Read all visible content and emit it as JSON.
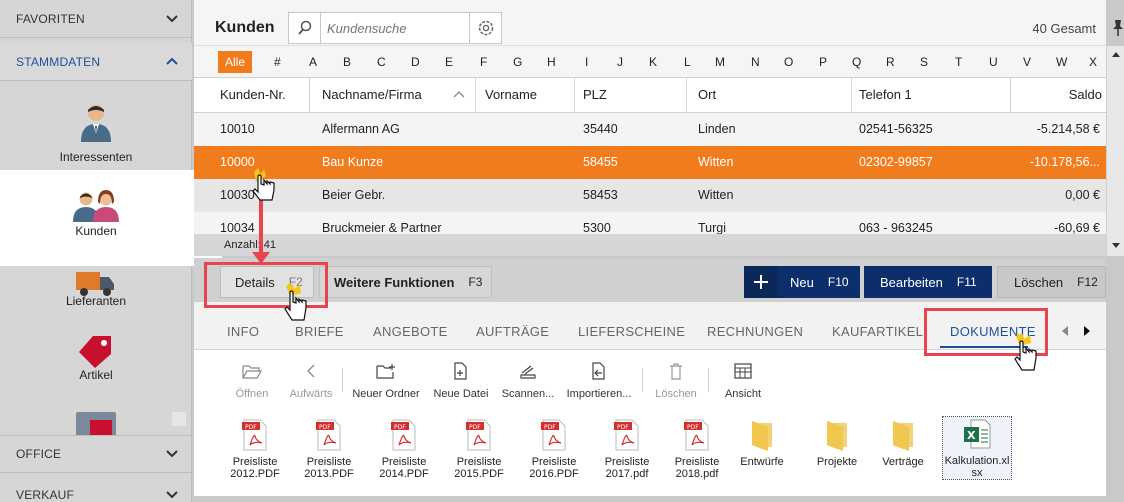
{
  "sidebar": {
    "sections": {
      "favoriten": "FAVORITEN",
      "stammdaten": "STAMMDATEN",
      "office": "OFFICE",
      "verkauf": "VERKAUF"
    },
    "items": [
      {
        "label": "Interessenten",
        "icon": "person-icon"
      },
      {
        "label": "Kunden",
        "icon": "people-icon"
      },
      {
        "label": "Lieferanten",
        "icon": "truck-icon"
      },
      {
        "label": "Artikel",
        "icon": "tag-icon"
      }
    ]
  },
  "header": {
    "title": "Kunden",
    "search_placeholder": "Kundensuche",
    "total": "40 Gesamt"
  },
  "alphabet": [
    "Alle",
    "#",
    "A",
    "B",
    "C",
    "D",
    "E",
    "F",
    "G",
    "H",
    "I",
    "J",
    "K",
    "L",
    "M",
    "N",
    "O",
    "P",
    "Q",
    "R",
    "S",
    "T",
    "U",
    "V",
    "W",
    "X"
  ],
  "table": {
    "columns": [
      "Kunden-Nr.",
      "Nachname/Firma",
      "Vorname",
      "PLZ",
      "Ort",
      "Telefon 1",
      "Saldo"
    ],
    "rows": [
      [
        "10010",
        "Alfermann AG",
        "",
        "35440",
        "Linden",
        "02541-56325",
        "-5.214,58 €"
      ],
      [
        "10000",
        "Bau Kunze",
        "",
        "58455",
        "Witten",
        "02302-99857",
        "-10.178,56..."
      ],
      [
        "10030",
        "Beier Gebr.",
        "",
        "58453",
        "Witten",
        "",
        "0,00 €"
      ],
      [
        "10034",
        "Bruckmeier & Partner",
        "",
        "5300",
        "Turgi",
        "063 - 963245",
        "-60,69 €"
      ]
    ],
    "count_label": "Anzahl: 41"
  },
  "actions": {
    "details": {
      "label": "Details",
      "key": "F2"
    },
    "weitere": {
      "label": "Weitere Funktionen",
      "key": "F3"
    },
    "neu": {
      "label": "Neu",
      "key": "F10"
    },
    "bearbeiten": {
      "label": "Bearbeiten",
      "key": "F11"
    },
    "loeschen": {
      "label": "Löschen",
      "key": "F12"
    }
  },
  "tabs": [
    "INFO",
    "BRIEFE",
    "ANGEBOTE",
    "AUFTRÄGE",
    "LIEFERSCHEINE",
    "RECHNUNGEN",
    "KAUFARTIKEL",
    "DOKUMENTE"
  ],
  "toolbar": [
    "Öffnen",
    "Aufwärts",
    "Neuer Ordner",
    "Neue Datei",
    "Scannen...",
    "Importieren...",
    "Löschen",
    "Ansicht"
  ],
  "files": [
    {
      "name": "Preisliste 2012.PDF",
      "type": "pdf"
    },
    {
      "name": "Preisliste 2013.PDF",
      "type": "pdf"
    },
    {
      "name": "Preisliste 2014.PDF",
      "type": "pdf"
    },
    {
      "name": "Preisliste 2015.PDF",
      "type": "pdf"
    },
    {
      "name": "Preisliste 2016.PDF",
      "type": "pdf"
    },
    {
      "name": "Preisliste 2017.pdf",
      "type": "pdf"
    },
    {
      "name": "Preisliste 2018.pdf",
      "type": "pdf"
    },
    {
      "name": "Entwürfe",
      "type": "folder"
    },
    {
      "name": "Projekte",
      "type": "folder"
    },
    {
      "name": "Verträge",
      "type": "folder"
    },
    {
      "name": "Kalkulation.xlsx",
      "type": "xlsx"
    }
  ],
  "colors": {
    "accent": "#f07c1e",
    "primary": "#0c2f6b",
    "highlight": "#e8434e"
  }
}
